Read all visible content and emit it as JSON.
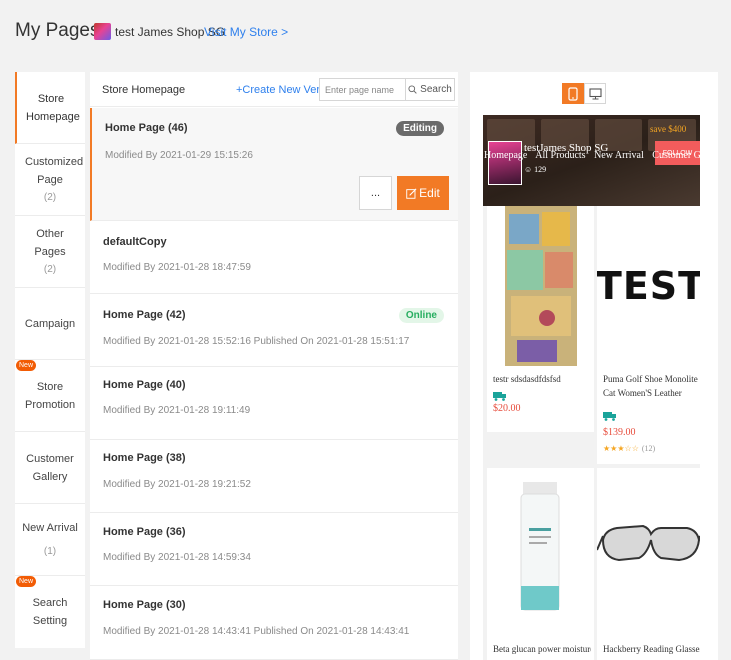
{
  "header": {
    "title": "My Pages",
    "store_name": "test James Shop SG",
    "visit_store": "Visit My Store >"
  },
  "sidebar": {
    "items": [
      {
        "label": "Store Homepage",
        "count": ""
      },
      {
        "label": "Customized Page",
        "count": "(2)"
      },
      {
        "label": "Other Pages",
        "count": "(2)"
      },
      {
        "label": "Campaign",
        "count": ""
      },
      {
        "label": "Store Promotion",
        "count": "",
        "badge": "New"
      },
      {
        "label": "Customer Gallery",
        "count": ""
      },
      {
        "label": "New Arrival",
        "count": "(1)"
      },
      {
        "label": "Search Setting",
        "count": "",
        "badge": "New"
      }
    ]
  },
  "pages_panel": {
    "title": "Store Homepage",
    "create_label": "+Create New Version",
    "search_placeholder": "Enter page name",
    "search_button": "Search",
    "items": [
      {
        "title": "Home Page (46)",
        "meta": "Modified By  2021-01-29 15:15:26",
        "status": "Editing"
      },
      {
        "title": "defaultCopy",
        "meta": "Modified By  2021-01-28 18:47:59",
        "status": ""
      },
      {
        "title": "Home Page (42)",
        "meta": "Modified By  2021-01-28 15:52:16    Published On  2021-01-28 15:51:17",
        "status": "Online"
      },
      {
        "title": "Home Page (40)",
        "meta": "Modified By  2021-01-28 19:11:49",
        "status": ""
      },
      {
        "title": "Home Page (38)",
        "meta": "Modified By  2021-01-28 19:21:52",
        "status": ""
      },
      {
        "title": "Home Page (36)",
        "meta": "Modified By  2021-01-28 14:59:34",
        "status": ""
      },
      {
        "title": "Home Page (30)",
        "meta": "Modified By  2021-01-28 14:43:41    Published On  2021-01-28 14:43:41",
        "status": ""
      }
    ],
    "more_label": "...",
    "edit_label": "Edit"
  },
  "preview": {
    "device_active": "mobile",
    "banner_sale": "save $400",
    "shop_name": "testJames Shop SG",
    "follower_count": "129",
    "follow_label": "FOLLOW",
    "nav": [
      "Homepage",
      "All Products",
      "New Arrival",
      "Customer G"
    ],
    "products": [
      {
        "name": "testr sdsdasdfdsfsd",
        "price": "$20.00",
        "rating": ""
      },
      {
        "name": "Puma Golf Shoe Monolite Cat Women'S Leather (Black)",
        "price": "$139.00",
        "rating": "★★★☆☆",
        "rating_count": "(12)"
      },
      {
        "name": "Beta glucan power moisture s",
        "price": ""
      },
      {
        "name": "Hackberry Reading Glasses",
        "price": ""
      }
    ],
    "test_label": "TEST",
    "colors": {
      "accent": "#f27a25",
      "price": "#e74c3c",
      "link": "#2f80ed",
      "online": "#27ae60",
      "truck": "#1aa39a"
    }
  }
}
